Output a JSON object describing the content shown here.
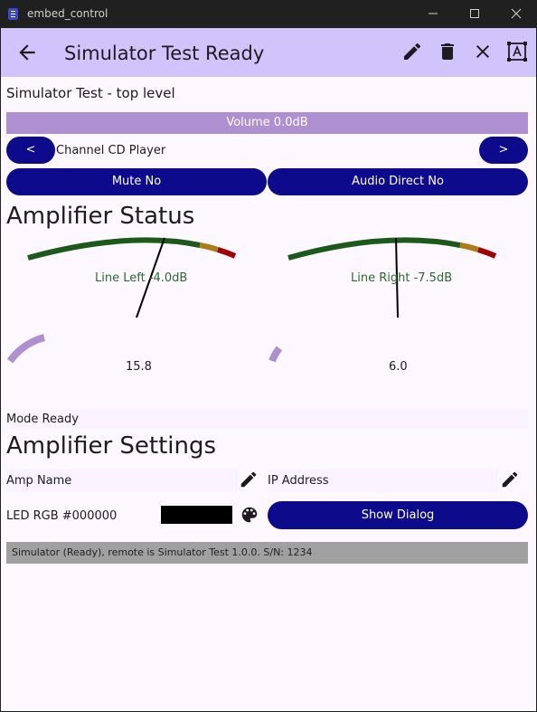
{
  "window": {
    "title": "embed_control"
  },
  "appbar": {
    "title": "Simulator Test Ready"
  },
  "subtitle": "Simulator Test - top level",
  "volume": {
    "label": "Volume 0.0dB"
  },
  "channel": {
    "prev": "<",
    "label": "Channel CD Player",
    "next": ">"
  },
  "toggles": {
    "mute": "Mute No",
    "audio_direct": "Audio Direct No"
  },
  "amplifier_status": {
    "heading": "Amplifier Status",
    "meters": [
      {
        "label": "Line Left -4.0dB",
        "value": "15.8"
      },
      {
        "label": "Line Right -7.5dB",
        "value": "6.0"
      }
    ]
  },
  "mode": "Mode Ready",
  "amplifier_settings": {
    "heading": "Amplifier Settings",
    "amp_name": "Amp Name",
    "ip_address": "IP Address",
    "led_rgb": "LED RGB #000000",
    "show_dialog": "Show Dialog"
  },
  "status_bar": "Simulator (Ready), remote is Simulator Test 1.0.0. S/N: 1234",
  "colors": {
    "appbar": "#d1c4fc",
    "button": "#0d0a8c",
    "volume_bar": "#ae8fcf",
    "meter_green": "#1c5a1c",
    "meter_orange": "#b07b17",
    "meter_red": "#a00000",
    "led_swatch": "#000000",
    "status_bar": "#a0a0a0"
  }
}
